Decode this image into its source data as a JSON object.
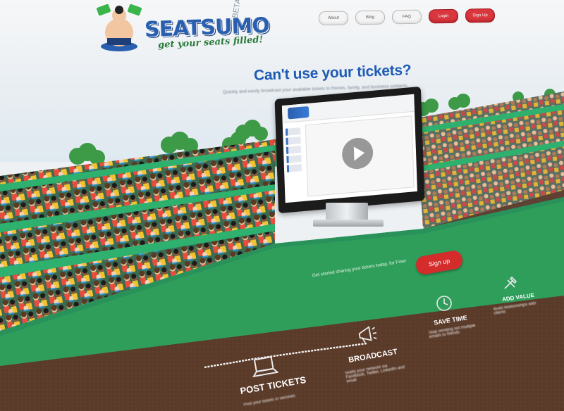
{
  "header": {
    "brand": "SEATSUMO",
    "beta": "BETA",
    "tagline": "get your seats filled!",
    "nav": [
      "About",
      "Blog",
      "FAQ",
      "Login",
      "Sign Up"
    ]
  },
  "hero": {
    "headline": "Can't use your tickets?",
    "subline": "Quickly and easily broadcast your available tickets to friends, family, and business contacts."
  },
  "cta": {
    "button": "Sign up",
    "promo": "Get started sharing your tickets today, for Free!"
  },
  "features": [
    {
      "title": "POST TICKETS",
      "icon": "laptop-icon",
      "desc": "Post your tickets in seconds"
    },
    {
      "title": "BROADCAST",
      "icon": "megaphone-icon",
      "desc": "Notify your network via Facebook, Twitter, LinkedIn and email"
    },
    {
      "title": "SAVE TIME",
      "icon": "clock-icon",
      "desc": "Stop sending out multiple emails to friends"
    },
    {
      "title": "ADD VALUE",
      "icon": "tools-icon",
      "desc": "Build relationships with clients"
    }
  ],
  "colors": {
    "brand_blue": "#2a5fb0",
    "grass": "#2f9e5b",
    "dirt": "#5b3b2a",
    "red": "#d42b2b"
  }
}
